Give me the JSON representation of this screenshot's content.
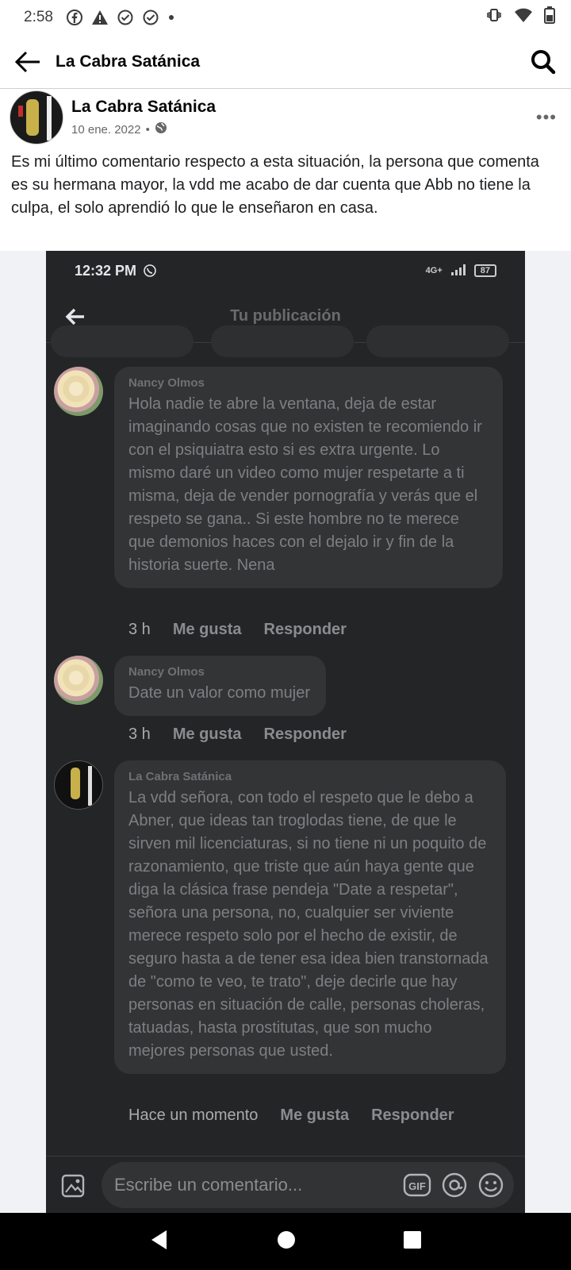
{
  "status_bar": {
    "time": "2:58"
  },
  "app_bar": {
    "title": "La Cabra Satánica"
  },
  "post": {
    "author": "La Cabra Satánica",
    "date": "10 ene. 2022",
    "text": "Es mi último comentario respecto a esta situación, la persona que comenta es su hermana mayor, la vdd me acabo de dar cuenta que Abb no tiene la culpa, el solo aprendió lo que le enseñaron en casa."
  },
  "embedded_screenshot": {
    "status_time": "12:32 PM",
    "network": "4G+",
    "battery": "87",
    "title": "Tu publicación",
    "comments": [
      {
        "author": "Nancy Olmos",
        "text": "Hola nadie te abre la ventana, deja de estar imaginando cosas que no existen te recomiendo ir con el psiquiatra esto si es extra urgente. Lo mismo daré un video como mujer respetarte a ti misma, deja de vender pornografía y verás que el respeto se gana.. Si este hombre no te merece que demonios haces con el dejalo ir y fin de la historia suerte. Nena",
        "time": "3 h",
        "like": "Me gusta",
        "reply": "Responder"
      },
      {
        "author": "Nancy Olmos",
        "text": "Date un valor como mujer",
        "time": "3 h",
        "like": "Me gusta",
        "reply": "Responder"
      },
      {
        "author": "La Cabra Satánica",
        "text": "La vdd señora, con todo el respeto que le debo a Abner, que ideas tan troglodas tiene, de que le sirven mil licenciaturas, si no tiene ni un poquito de razonamiento, que triste que aún haya gente que diga la clásica frase pendeja \"Date a respetar\", señora una persona, no, cualquier ser viviente merece respeto solo por el hecho de existir, de seguro hasta a de tener esa idea bien transtornada de \"como te veo, te trato\", deje decirle que hay personas en situación de calle, personas choleras, tatuadas, hasta prostitutas, que son mucho mejores personas que usted.",
        "time": "Hace un momento",
        "like": "Me gusta",
        "reply": "Responder"
      }
    ],
    "comment_placeholder": "Escribe un comentario..."
  },
  "icons": [
    "back-arrow-icon",
    "search-icon",
    "more-options-icon",
    "globe-icon",
    "image-icon",
    "gif-icon",
    "mention-icon",
    "emoji-icon",
    "nav-back-icon",
    "nav-home-icon",
    "nav-recents-icon"
  ],
  "colors": {
    "dark_bg": "#242526",
    "bubble": "#333435",
    "nav_bg": "#000000"
  }
}
